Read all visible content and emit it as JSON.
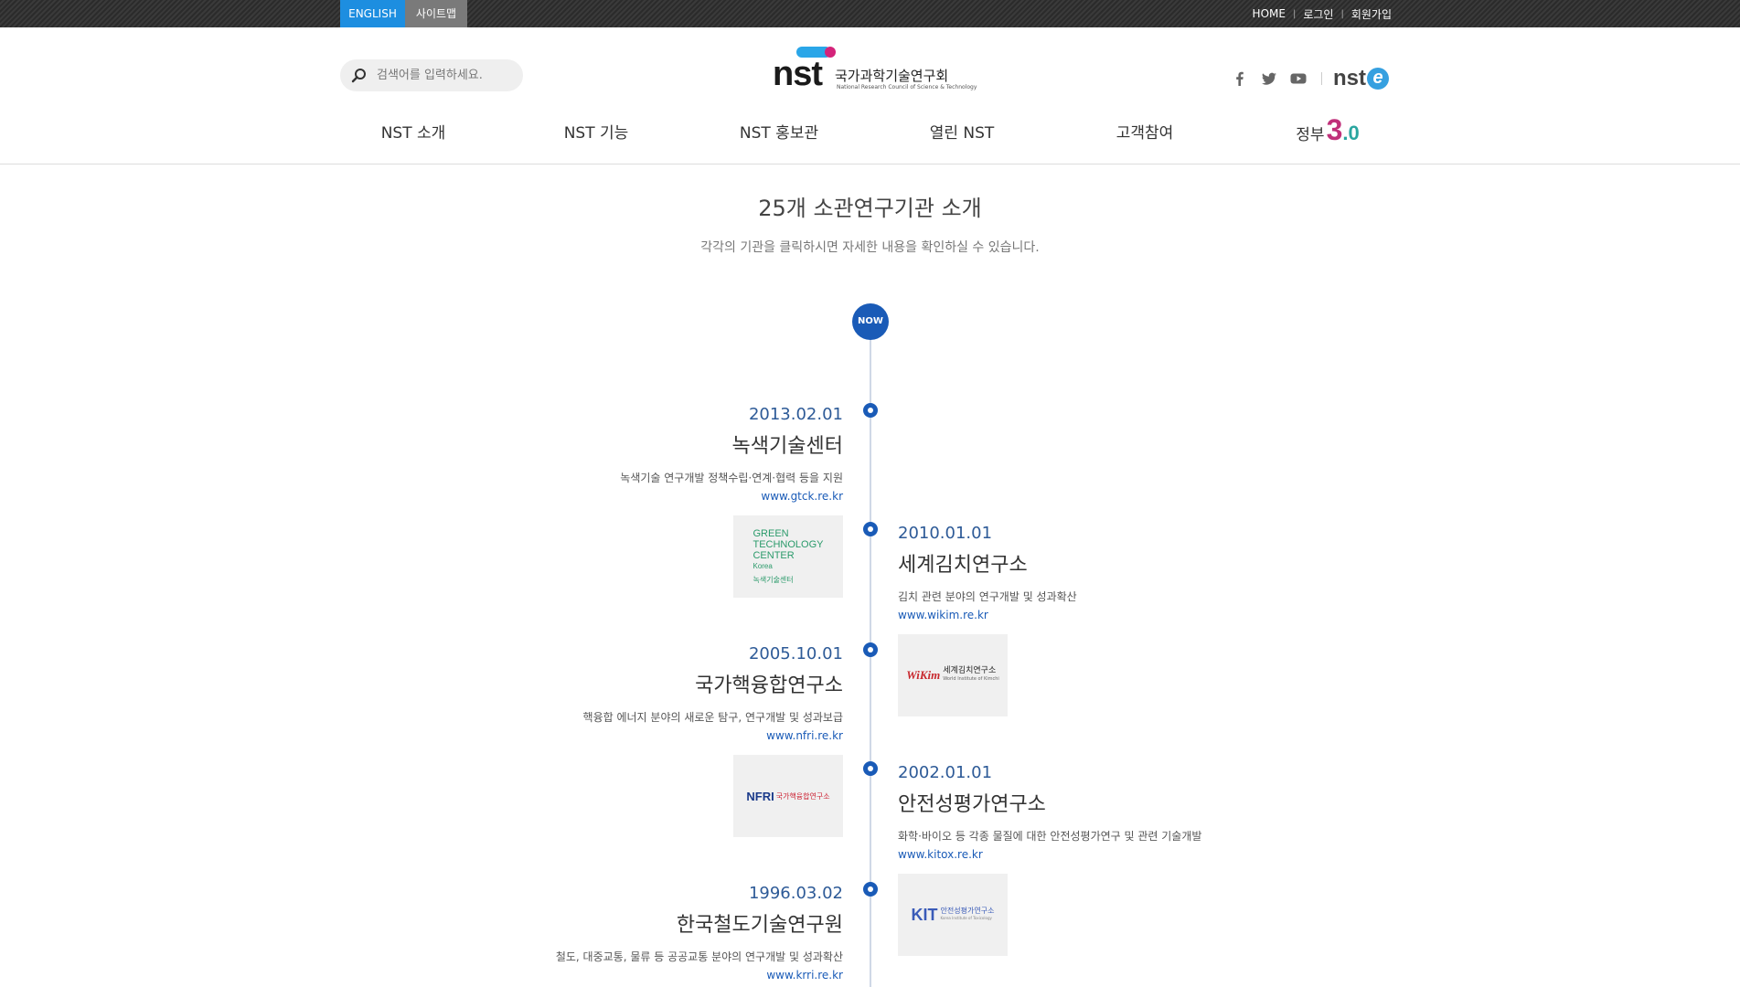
{
  "topbar": {
    "lang": "ENGLISH",
    "sitemap": "사이트맵",
    "links": [
      "HOME",
      "로그인",
      "회원가입"
    ]
  },
  "header": {
    "search_placeholder": "검색어를 입력하세요.",
    "logo_text": "nst",
    "logo_kor": "국가과학기술연구회",
    "logo_eng": "National Research Council of Science & Technology",
    "nste": "nst"
  },
  "nav": {
    "items": [
      "NST 소개",
      "NST 기능",
      "NST 홍보관",
      "열린 NST",
      "고객참여"
    ],
    "gov_label": "정부",
    "gov_num": "3",
    "gov_dec": ".0"
  },
  "page": {
    "title": "25개 소관연구기관 소개",
    "subtitle": "각각의 기관을 클릭하시면 자세한 내용을 확인하실 수 있습니다."
  },
  "timeline": {
    "now_label": "NOW",
    "entries": [
      {
        "date": "2013.02.01",
        "name": "녹색기술센터",
        "desc": "녹색기술 연구개발 정책수립·연계·협력 등을 지원",
        "url": "www.gtck.re.kr",
        "logo_lines": [
          "GREEN",
          "TECHNOLOGY",
          "CENTER",
          "Korea",
          "녹색기술센터"
        ]
      },
      {
        "date": "2010.01.01",
        "name": "세계김치연구소",
        "desc": "김치 관련 분야의 연구개발 및 성과확산",
        "url": "www.wikim.re.kr",
        "logo_main": "WiKim",
        "logo_kor": "세계김치연구소",
        "logo_sub": "World Institute of Kimchi"
      },
      {
        "date": "2005.10.01",
        "name": "국가핵융합연구소",
        "desc": "핵융합 에너지 분야의 새로운 탐구, 연구개발 및 성과보급",
        "url": "www.nfri.re.kr",
        "logo_main": "NFRI",
        "logo_kor": "국가핵융합연구소"
      },
      {
        "date": "2002.01.01",
        "name": "안전성평가연구소",
        "desc": "화학·바이오 등 각종 물질에 대한 안전성평가연구 및 관련 기술개발",
        "url": "www.kitox.re.kr",
        "logo_main": "KIT",
        "logo_kor": "안전성평가연구소",
        "logo_sub": "Korea Institute of Toxicology"
      },
      {
        "date": "1996.03.02",
        "name": "한국철도기술연구원",
        "desc": "철도, 대중교통, 물류 등 공공교통 분야의 연구개발 및 성과확산",
        "url": "www.krri.re.kr"
      }
    ]
  }
}
